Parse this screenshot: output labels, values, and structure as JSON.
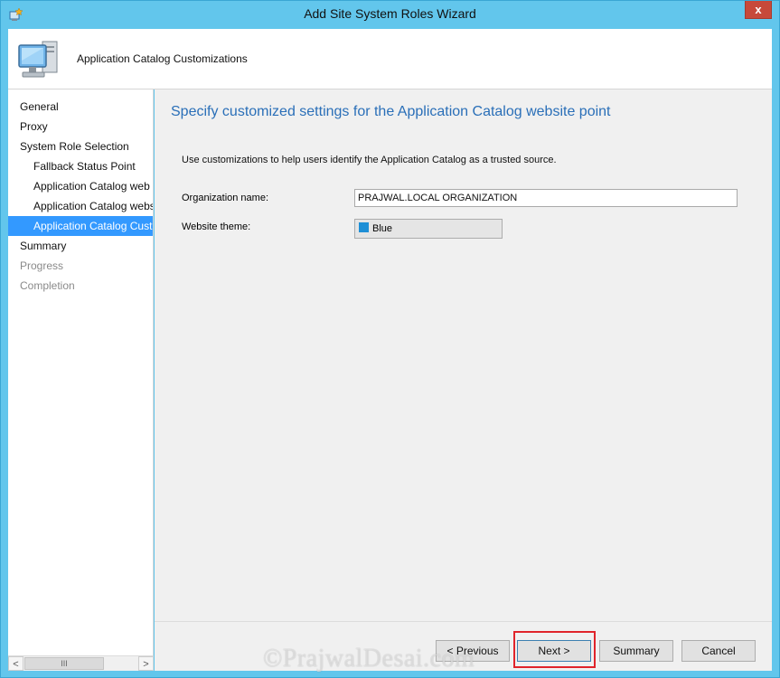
{
  "window": {
    "title": "Add Site System Roles Wizard",
    "close_glyph": "x"
  },
  "header": {
    "title": "Application Catalog Customizations"
  },
  "nav": {
    "items": [
      {
        "label": "General",
        "level": 0,
        "state": "normal"
      },
      {
        "label": "Proxy",
        "level": 0,
        "state": "normal"
      },
      {
        "label": "System Role Selection",
        "level": 0,
        "state": "normal"
      },
      {
        "label": "Fallback Status Point",
        "level": 1,
        "state": "normal"
      },
      {
        "label": "Application Catalog web",
        "level": 1,
        "state": "normal"
      },
      {
        "label": "Application Catalog webs",
        "level": 1,
        "state": "normal"
      },
      {
        "label": "Application Catalog Cust",
        "level": 1,
        "state": "selected"
      },
      {
        "label": "Summary",
        "level": 0,
        "state": "normal"
      },
      {
        "label": "Progress",
        "level": 0,
        "state": "disabled"
      },
      {
        "label": "Completion",
        "level": 0,
        "state": "disabled"
      }
    ],
    "scroll_left": "<",
    "scroll_right": ">",
    "scroll_thumb": "III"
  },
  "content": {
    "heading": "Specify customized settings for the Application Catalog website point",
    "intro": "Use customizations to help users identify the Application Catalog as a trusted source.",
    "org_label": "Organization name:",
    "org_value": "PRAJWAL.LOCAL ORGANIZATION",
    "theme_label": "Website theme:",
    "theme_value": "Blue",
    "theme_color": "#1e8fd6"
  },
  "footer": {
    "previous": "< Previous",
    "next": "Next >",
    "summary": "Summary",
    "cancel": "Cancel"
  },
  "watermark": "©PrajwalDesai.com",
  "colors": {
    "chrome": "#62c6ec",
    "selection": "#3399ff",
    "heading": "#2a6fb8",
    "highlight_box": "#e0242b"
  }
}
